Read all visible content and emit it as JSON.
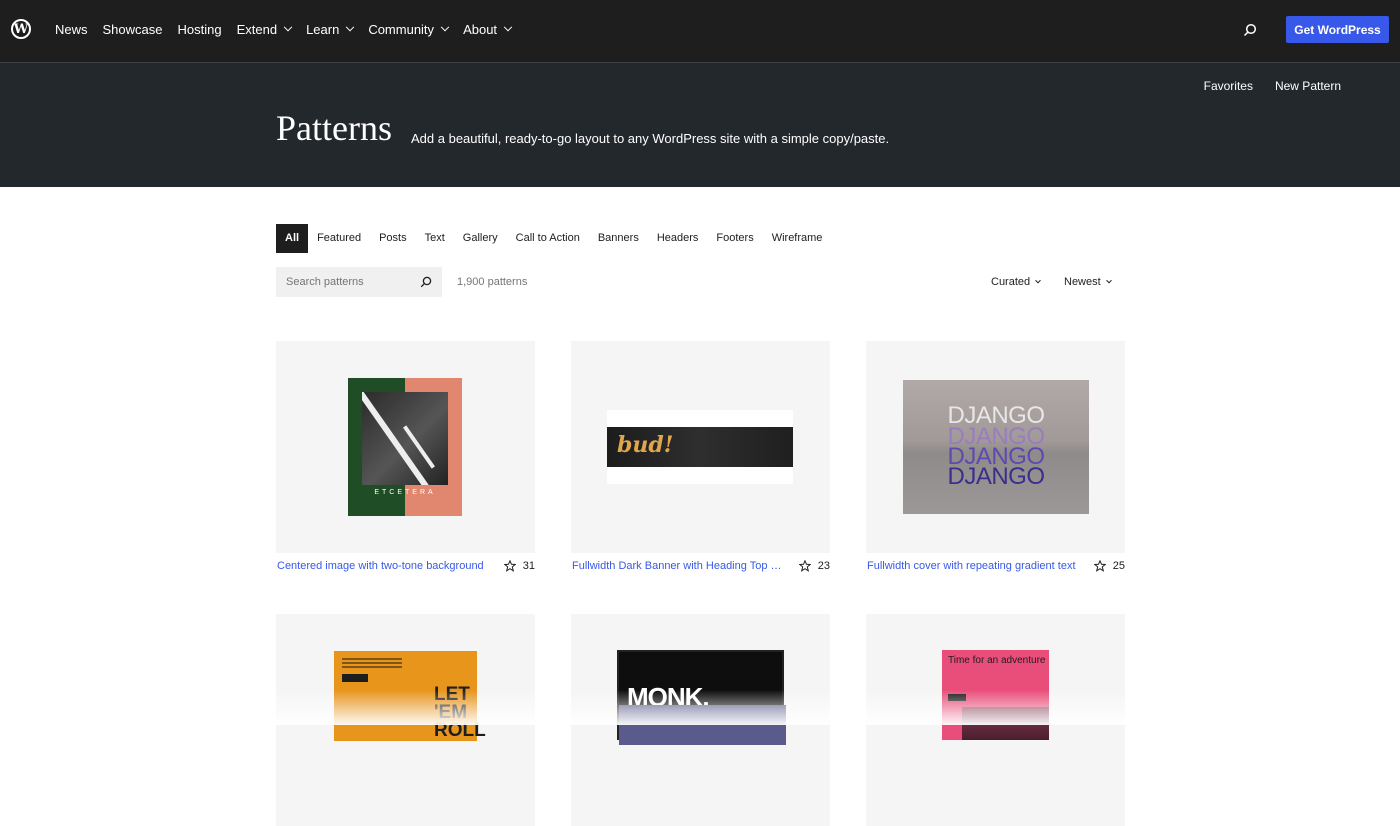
{
  "topbar": {
    "logo": "W",
    "nav": [
      {
        "label": "News",
        "has_dropdown": false
      },
      {
        "label": "Showcase",
        "has_dropdown": false
      },
      {
        "label": "Hosting",
        "has_dropdown": false
      },
      {
        "label": "Extend",
        "has_dropdown": true
      },
      {
        "label": "Learn",
        "has_dropdown": true
      },
      {
        "label": "Community",
        "has_dropdown": true
      },
      {
        "label": "About",
        "has_dropdown": true
      }
    ],
    "cta": "Get WordPress"
  },
  "hero": {
    "links": [
      "Favorites",
      "New Pattern"
    ],
    "title": "Patterns",
    "description": "Add a beautiful, ready-to-go layout to any WordPress site with a simple copy/paste."
  },
  "filters": [
    "All",
    "Featured",
    "Posts",
    "Text",
    "Gallery",
    "Call to Action",
    "Banners",
    "Headers",
    "Footers",
    "Wireframe"
  ],
  "active_filter": "All",
  "search": {
    "placeholder": "Search patterns"
  },
  "pattern_count": "1,900 patterns",
  "sort": {
    "curated": "Curated",
    "newest": "Newest"
  },
  "cards": [
    {
      "title": "Centered image with two-tone background",
      "favorites": "31",
      "thumb_text": "ETCETERA"
    },
    {
      "title": "Fullwidth Dark Banner with Heading Top Left",
      "favorites": "23",
      "thumb_text": "bud!"
    },
    {
      "title": "Fullwidth cover with repeating gradient text",
      "favorites": "25",
      "thumb_text": "DJANGO"
    },
    {
      "title": "",
      "favorites": "",
      "thumb_text": "LET 'EM ROLL"
    },
    {
      "title": "",
      "favorites": "",
      "thumb_text": "MONK."
    },
    {
      "title": "",
      "favorites": "",
      "thumb_text": "Time for an adventure"
    }
  ],
  "colors": {
    "accent": "#3858e9",
    "dark": "#1e1e1e",
    "hero": "#23282d"
  }
}
